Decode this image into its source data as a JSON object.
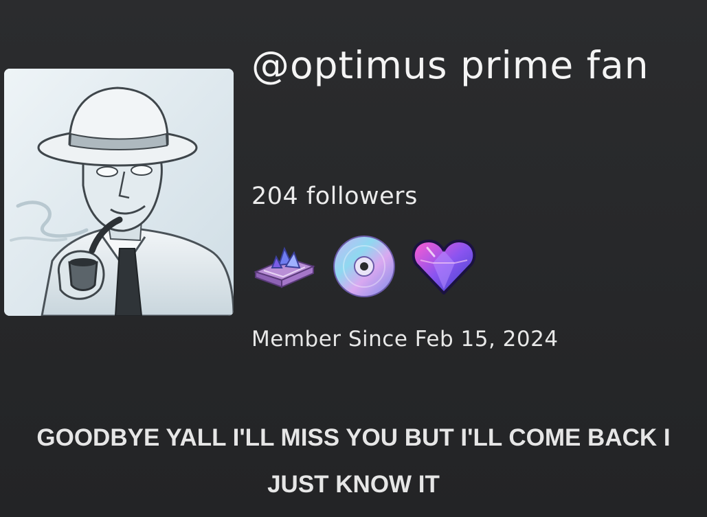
{
  "profile": {
    "username": "@optimus prime fan",
    "followers_text": "204 followers",
    "member_since": "Member Since Feb 15, 2024",
    "bio": "GOODBYE YALL I'LL MISS YOU BUT I'LL COME BACK I JUST KNOW IT",
    "avatar_icon": "man-with-hat-and-pipe-avatar",
    "badges": [
      {
        "icon": "crystal-book-badge-icon"
      },
      {
        "icon": "compact-disc-badge-icon"
      },
      {
        "icon": "gem-heart-badge-icon"
      }
    ]
  },
  "colors": {
    "background": "#28292b",
    "text": "#f1f1f1"
  }
}
